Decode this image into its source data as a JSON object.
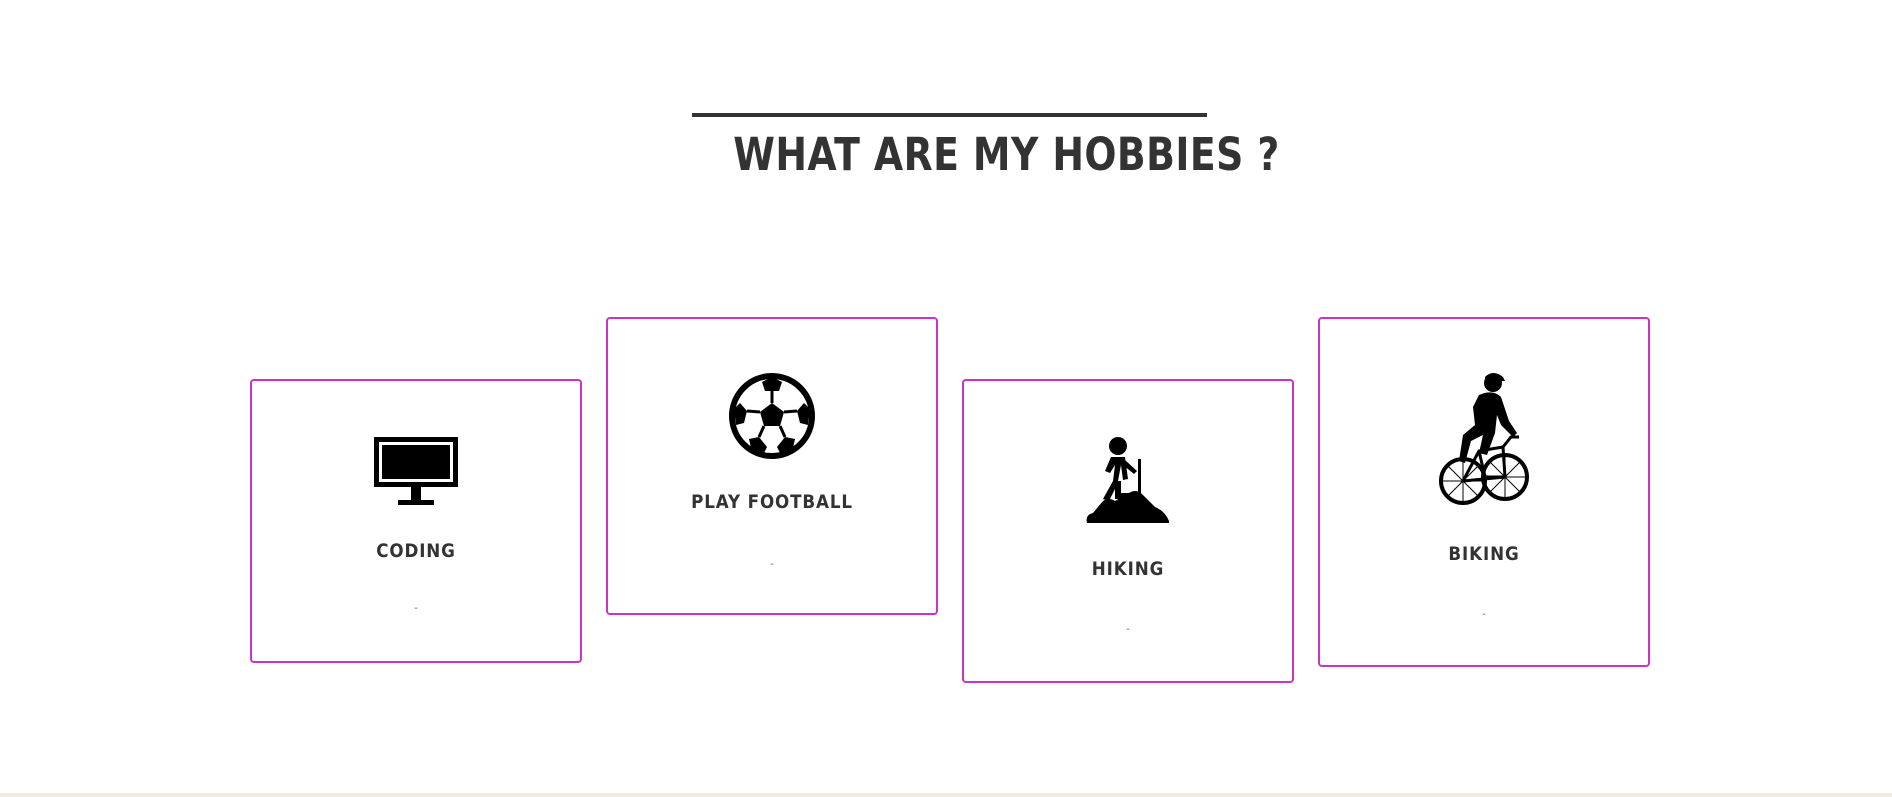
{
  "section": {
    "title": "WHAT ARE MY HOBBIES ?"
  },
  "colors": {
    "card_border": "#cc33c4",
    "heading": "#333333",
    "icon": "#000000"
  },
  "hobbies": [
    {
      "title": "CODING",
      "description": "-",
      "icon": "monitor-icon"
    },
    {
      "title": "PLAY FOOTBALL",
      "description": "-",
      "icon": "soccer-ball-icon"
    },
    {
      "title": "HIKING",
      "description": "-",
      "icon": "hiker-icon"
    },
    {
      "title": "BIKING",
      "description": "-",
      "icon": "cyclist-icon"
    }
  ]
}
